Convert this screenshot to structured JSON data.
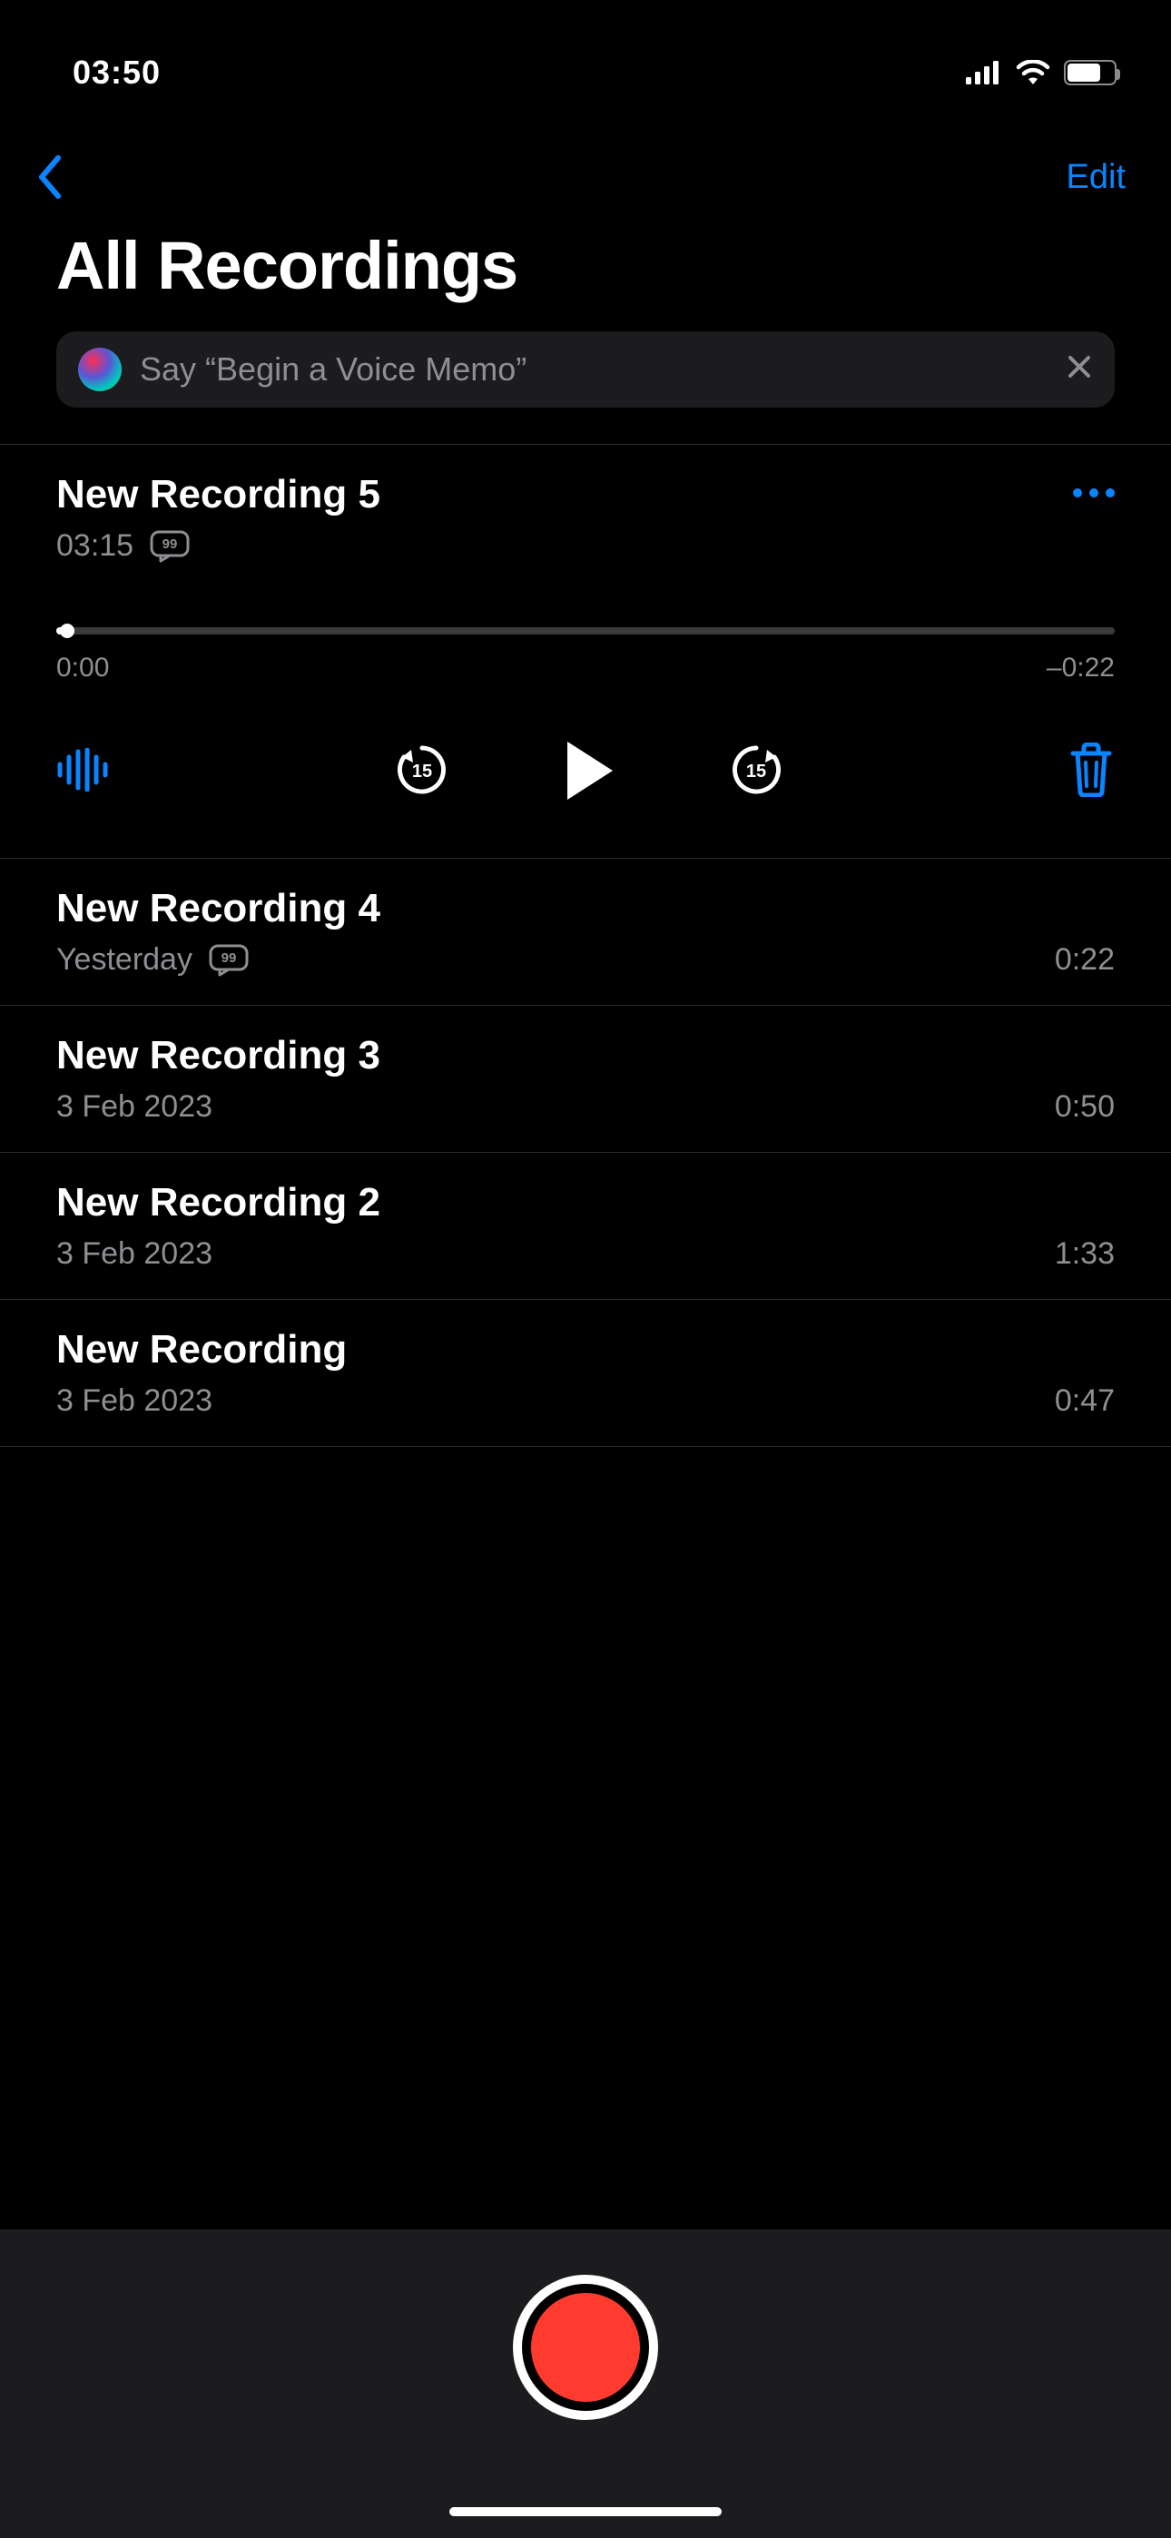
{
  "status": {
    "time": "03:50",
    "battery_pct": 71,
    "battery_label": "71"
  },
  "nav": {
    "edit_label": "Edit"
  },
  "title": "All Recordings",
  "siri": {
    "prefix": "Say ",
    "quote_open": "“",
    "phrase": "Begin a Voice Memo",
    "quote_close": "”"
  },
  "selected": {
    "title": "New Recording 5",
    "date": "03:15",
    "elapsed": "0:00",
    "remaining": "–0:22",
    "progress_pct": 1,
    "skip_seconds": "15"
  },
  "recordings": [
    {
      "title": "New Recording 4",
      "date": "Yesterday",
      "duration": "0:22",
      "transcribed": true
    },
    {
      "title": "New Recording 3",
      "date": "3 Feb 2023",
      "duration": "0:50",
      "transcribed": false
    },
    {
      "title": "New Recording 2",
      "date": "3 Feb 2023",
      "duration": "1:33",
      "transcribed": false
    },
    {
      "title": "New Recording",
      "date": "3 Feb 2023",
      "duration": "0:47",
      "transcribed": false
    }
  ],
  "colors": {
    "accent": "#0a84ff",
    "record": "#ff3b30"
  }
}
